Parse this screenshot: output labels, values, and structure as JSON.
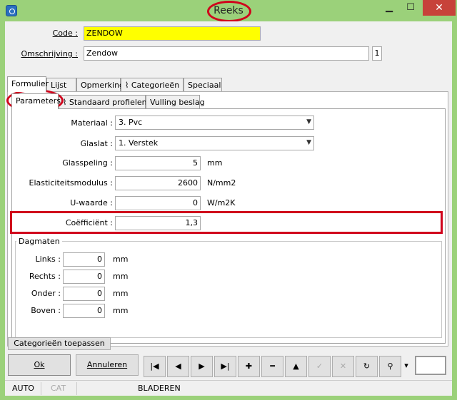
{
  "window": {
    "title": "Reeks",
    "min_icon": "minimize-icon",
    "max_icon": "maximize-icon",
    "close_icon": "close-icon"
  },
  "header": {
    "code_label": "Code :",
    "code_value": "ZENDOW",
    "omschrijving_label": "Omschrijving :",
    "omschrijving_value": "Zendow",
    "counter": "1",
    "code_bg": "#ffff00"
  },
  "tabs": [
    "Formulier",
    "Lijst",
    "Opmerking",
    "Categorieën",
    "Speciaal"
  ],
  "subtabs": [
    "Parameters",
    "Standaard profielen",
    "Vulling beslag"
  ],
  "params": {
    "materiaal_label": "Materiaal :",
    "materiaal_value": "3.  Pvc",
    "glaslat_label": "Glaslat :",
    "glaslat_value": "1.  Verstek",
    "glasspeling_label": "Glasspeling :",
    "glasspeling_value": "5",
    "glasspeling_unit": "mm",
    "elasticiteit_label": "Elasticiteitsmodulus :",
    "elasticiteit_value": "2600",
    "elasticiteit_unit": "N/mm2",
    "uwaarde_label": "U-waarde :",
    "uwaarde_value": "0",
    "uwaarde_unit": "W/m2K",
    "coefficient_label": "Coëfficiënt :",
    "coefficient_value": "1,3"
  },
  "dagmaten": {
    "title": "Dagmaten",
    "rows": [
      {
        "label": "Links :",
        "value": "0",
        "unit": "mm"
      },
      {
        "label": "Rechts :",
        "value": "0",
        "unit": "mm"
      },
      {
        "label": "Onder :",
        "value": "0",
        "unit": "mm"
      },
      {
        "label": "Boven :",
        "value": "0",
        "unit": "mm"
      }
    ]
  },
  "footer": {
    "apply_label": "Categorieën toepassen",
    "ok_label": "Ok",
    "cancel_label": "Annuleren"
  },
  "nav": {
    "first": "|◀",
    "prev": "◀",
    "next": "▶",
    "last": "▶|",
    "add": "✚",
    "remove": "━",
    "up": "▲",
    "check": "✓",
    "cross": "✕",
    "refresh": "↻",
    "search": "⚲",
    "dropdown": "▾"
  },
  "status": {
    "mode1": "AUTO",
    "mode2": "CAT",
    "mode3": "BLADEREN"
  },
  "accent": "#d0021b"
}
